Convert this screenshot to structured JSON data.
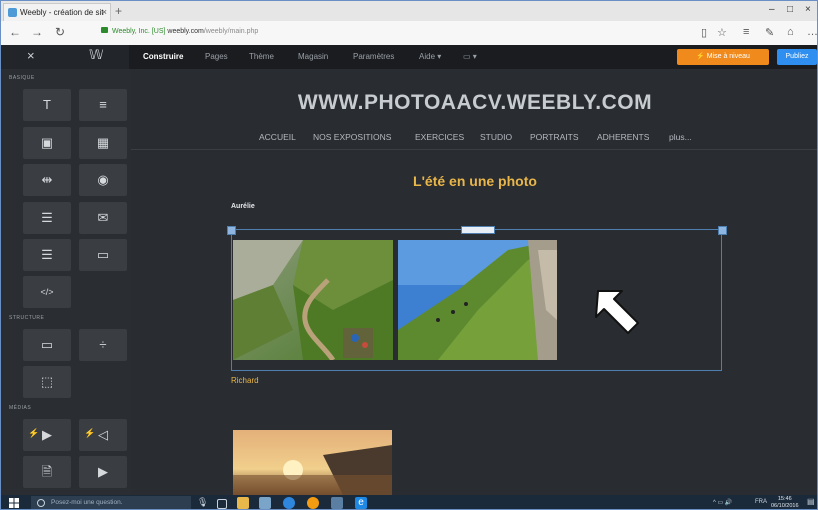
{
  "browser": {
    "tab_title": "Weebly - création de sit",
    "tab_close": "×",
    "new_tab": "+",
    "minimize": "–",
    "restore": "□",
    "close": "×",
    "url_org": "Weebly, Inc. [US]",
    "url_host": "weebly.com",
    "url_path": "/weebly/main.php"
  },
  "weebly_toolbar": {
    "close_glyph": "×",
    "logo_glyph": "𝕎",
    "nav": [
      "Construire",
      "Pages",
      "Thème",
      "Magasin",
      "Paramètres",
      "Aide ▾"
    ],
    "device_glyph": "▭ ▾",
    "upgrade_label": "⚡ Mise à niveau",
    "publish_label": "Publiez"
  },
  "sidebar": {
    "sections": [
      "BASIQUE",
      "STRUCTURE",
      "MÉDIAS"
    ],
    "basic_tiles": [
      "T",
      "≡",
      "▣",
      "▦",
      "⇹",
      "◉",
      "☰",
      "✉",
      "☰",
      "▭",
      "</>"
    ],
    "structure_tiles": [
      "▭",
      "÷",
      "⬚"
    ],
    "media_tiles": [
      "▶",
      "◁",
      "🗎",
      "▶"
    ]
  },
  "site": {
    "title": "WWW.PHOTOAACV.WEEBLY.COM",
    "menu": [
      "ACCUEIL",
      "NOS EXPOSITIONS",
      "EXERCICES",
      "STUDIO",
      "PORTRAITS",
      "ADHERENTS",
      "plus..."
    ],
    "page_title": "L'été en une photo",
    "author1": "Aurélie",
    "author2": "Richard"
  },
  "taskbar": {
    "search_placeholder": "Posez-moi une question.",
    "lang": "FRA",
    "time": "15:46",
    "date": "06/10/2016"
  },
  "colors": {
    "accent_orange": "#f08a1c",
    "publish_blue": "#2f8ff0",
    "title_gold": "#e9b64a"
  }
}
